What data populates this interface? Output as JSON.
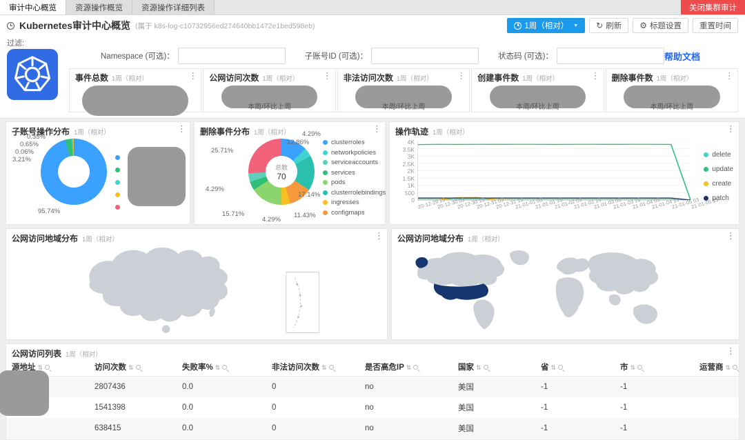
{
  "colors": {
    "accent_blue": "#1b9aec",
    "danger_red": "#ee4c4c",
    "k8s_blue": "#326ce5",
    "link_blue": "#1a66ff",
    "redact_gray": "#9a9a9a",
    "map_gray": "#cbd0d6",
    "map_highlight": "#14356f"
  },
  "icons": {
    "kebab": "⋮",
    "caret_down": "▼",
    "refresh": "↻",
    "gear": "⚙",
    "sort": "⇅"
  },
  "tabbar": {
    "tabs": [
      {
        "label": "审计中心概览",
        "active": true
      },
      {
        "label": "资源操作概览",
        "active": false
      },
      {
        "label": "资源操作详细列表",
        "active": false
      }
    ],
    "close_button": "关闭集群审计"
  },
  "header": {
    "title": "Kubernetes审计中心概览",
    "subtitle": "(属于 k8s-log-c10732956ed274640bb1472e1bed598eb)",
    "time_button": "1周（相对）",
    "refresh_button": "刷新",
    "title_settings_button": "标题设置",
    "reset_time_button": "重置时间"
  },
  "filter": {
    "label": "过滤:",
    "fields": [
      {
        "label": "Namespace (可选)："
      },
      {
        "label": "子账号ID (可选)："
      },
      {
        "label": "状态码 (可选)："
      }
    ],
    "help_link": "帮助文档"
  },
  "stat_cards": [
    {
      "title": "事件总数",
      "period": "1周（相对）",
      "footer": ""
    },
    {
      "title": "公网访问次数",
      "period": "1周（相对）",
      "footer": "本周/环比上周"
    },
    {
      "title": "非法访问次数",
      "period": "1周（相对）",
      "footer": "本周/环比上周"
    },
    {
      "title": "创建事件数",
      "period": "1周（相对）",
      "footer": "本周/环比上周"
    },
    {
      "title": "删除事件数",
      "period": "1周（相对）",
      "footer": "本周/环比上周"
    }
  ],
  "chart_data": [
    {
      "type": "pie",
      "title": "子账号操作分布",
      "period": "1周（相对）",
      "donut": true,
      "legend_redacted": true,
      "slices": [
        {
          "label": "",
          "value": 95.74,
          "color": "#3aa1ff"
        },
        {
          "label": "",
          "value": 3.21,
          "color": "#30bf78"
        },
        {
          "label": "",
          "value": 0.65,
          "color": "#3fd4cf"
        },
        {
          "label": "",
          "value": 0.35,
          "color": "#f6c022"
        },
        {
          "label": "",
          "value": 0.06,
          "color": "#f2637b"
        }
      ],
      "callouts": [
        "0.35%",
        "0.65%",
        "0.06%",
        "3.21%",
        "95.74%"
      ]
    },
    {
      "type": "pie",
      "title": "删除事件分布",
      "period": "1周（相对）",
      "donut": true,
      "center_label": "总数",
      "center_value": "70",
      "slices": [
        {
          "label": "clusterroles",
          "value": 12.86,
          "color": "#3aa1ff"
        },
        {
          "label": "networkpolicies",
          "value": 4.29,
          "color": "#3fd4cf"
        },
        {
          "label": "clusterrolebindings",
          "value": 17.14,
          "color": "#2bbfae"
        },
        {
          "label": "configmaps",
          "value": 11.43,
          "color": "#f79a3e"
        },
        {
          "label": "ingresses",
          "value": 4.29,
          "color": "#f6c022"
        },
        {
          "label": "pods",
          "value": 15.71,
          "color": "#8bd46e"
        },
        {
          "label": "services",
          "value": 4.29,
          "color": "#30bf78"
        },
        {
          "label": "serviceaccounts",
          "value": 4.29,
          "color": "#5ecfba"
        },
        {
          "label": "",
          "value": 25.72,
          "color": "#f2637b"
        }
      ],
      "legend": [
        "clusterroles",
        "networkpolicies",
        "serviceaccounts",
        "services",
        "pods",
        "clusterrolebindings",
        "ingresses",
        "configmaps"
      ],
      "callouts": [
        "12.86%",
        "4.29%",
        "25.71%",
        "4.29%",
        "17.14%",
        "15.71%",
        "4.29%",
        "11.43%"
      ]
    },
    {
      "type": "line",
      "title": "操作轨迹",
      "period": "1周（相对）",
      "ylim": [
        0,
        4000
      ],
      "yticks": [
        "4K",
        "3.5K",
        "3K",
        "2.5K",
        "2K",
        "1.5K",
        "1K",
        "500",
        "0"
      ],
      "x": [
        "20-12-29 15",
        "20-12-30 03",
        "20-12-30 15",
        "20-12-31 03",
        "20-12-31 15",
        "21-01-01 03",
        "21-01-01 15",
        "21-01-02 03",
        "21-01-02 15",
        "21-01-03 03",
        "21-01-03 15",
        "21-01-04 03",
        "21-01-04 15",
        "21-01-05 03",
        "21-01-05 15"
      ],
      "legend_position": "right",
      "series": [
        {
          "name": "delete",
          "color": "#3fd4cf",
          "values": [
            40,
            40,
            40,
            40,
            40,
            40,
            40,
            40,
            40,
            40,
            40,
            40,
            40,
            40,
            0
          ]
        },
        {
          "name": "update",
          "color": "#30bf78",
          "values": [
            3780,
            3800,
            3790,
            3800,
            3795,
            3800,
            3800,
            3790,
            3800,
            3800,
            3795,
            3800,
            3800,
            3790,
            0
          ]
        },
        {
          "name": "create",
          "color": "#f6c022",
          "values": [
            20,
            20,
            160,
            180,
            40,
            20,
            20,
            20,
            20,
            20,
            20,
            20,
            20,
            20,
            0
          ]
        },
        {
          "name": "patch",
          "color": "#1d2e6b",
          "values": [
            130,
            130,
            130,
            130,
            130,
            130,
            130,
            130,
            130,
            130,
            130,
            130,
            130,
            130,
            0
          ]
        }
      ]
    }
  ],
  "map_panels": {
    "china": {
      "title": "公网访问地域分布",
      "period": "1周（相对）"
    },
    "world": {
      "title": "公网访问地域分布",
      "period": "1周（相对）"
    }
  },
  "access_table": {
    "title": "公网访问列表",
    "period": "1周（相对）",
    "columns": [
      "源地址",
      "访问次数",
      "失败率%",
      "非法访问次数",
      "是否高危IP",
      "国家",
      "省",
      "市",
      "运营商"
    ],
    "rows": [
      [
        "",
        "2807436",
        "0.0",
        "0",
        "no",
        "美国",
        "-1",
        "-1",
        ""
      ],
      [
        "",
        "1541398",
        "0.0",
        "0",
        "no",
        "美国",
        "-1",
        "-1",
        ""
      ],
      [
        "",
        "638415",
        "0.0",
        "0",
        "no",
        "美国",
        "-1",
        "-1",
        ""
      ]
    ]
  }
}
